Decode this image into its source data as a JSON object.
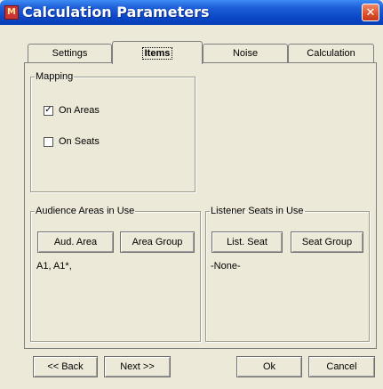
{
  "window": {
    "title": "Calculation Parameters",
    "app_icon_glyph": "M",
    "close_glyph": "✕",
    "icons": {
      "app": "app-icon",
      "close": "close-icon"
    },
    "colors": {
      "titlebar": "#0b47c7",
      "close": "#d9502b",
      "face": "#ece9d8"
    }
  },
  "tabs": [
    {
      "label": "Settings",
      "active": false
    },
    {
      "label": "Items",
      "active": true
    },
    {
      "label": "Noise",
      "active": false
    },
    {
      "label": "Calculation",
      "active": false
    }
  ],
  "mapping": {
    "label": "Mapping",
    "on_areas": {
      "label": "On Areas",
      "checked": true,
      "mark": "✓"
    },
    "on_seats": {
      "label": "On Seats",
      "checked": false,
      "mark": ""
    }
  },
  "audience": {
    "label": "Audience Areas in Use",
    "aud_area_button": "Aud. Area",
    "area_group_button": "Area Group",
    "value": "A1, A1*,"
  },
  "listener": {
    "label": "Listener Seats in Use",
    "list_seat_button": "List. Seat",
    "seat_group_button": "Seat Group",
    "value": "-None-"
  },
  "footer": {
    "back": "<< Back",
    "next": "Next >>",
    "ok": "Ok",
    "cancel": "Cancel"
  }
}
